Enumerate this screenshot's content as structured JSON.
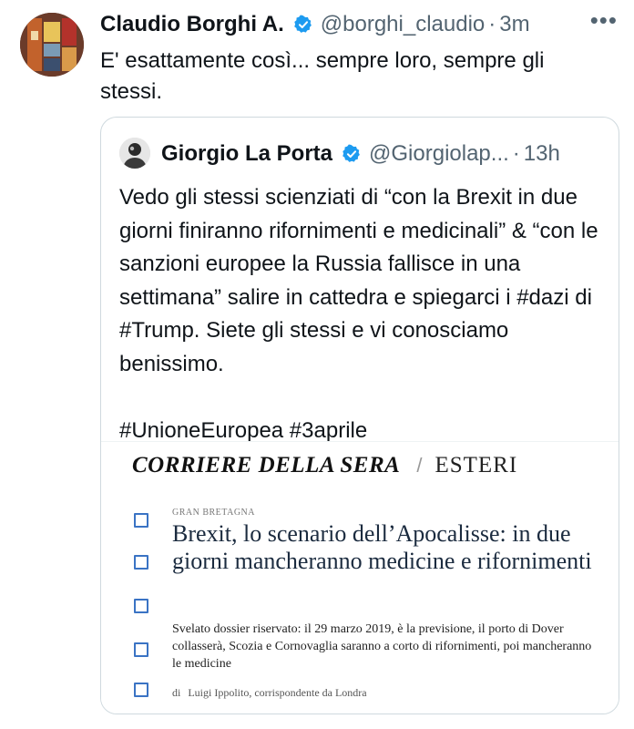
{
  "tweet": {
    "author_name": "Claudio Borghi A.",
    "handle": "@borghi_claudio",
    "separator": "·",
    "time": "3m",
    "more_icon": "more-icon",
    "verified_icon": "verified-badge-icon",
    "text": "E' esattamente così... sempre loro, sempre gli stessi."
  },
  "quoted_tweet": {
    "author_name": "Giorgio La Porta",
    "handle": "@Giorgiolap...",
    "separator": "·",
    "time": "13h",
    "verified_icon": "verified-badge-icon",
    "text": "Vedo gli stessi scienziati di “con la Brexit in due giorni finiranno rifornimenti e medicinali” & “con le sanzioni europee la Russia fallisce in una settimana” salire in cattedra e spiegarci i #dazi di #Trump. Siete gli stessi e vi conosciamo benissimo.\n\n#UnioneEuropea #3aprile"
  },
  "article_image": {
    "paper_name": "CORRIERE DELLA SERA",
    "separator": "/",
    "section": "ESTERI",
    "kicker": "GRAN BRETAGNA",
    "headline": "Brexit, lo scenario dell’Apocalisse: in due giorni mancheranno medicine e rifornimenti",
    "summary": "Svelato dossier riservato: il 29 marzo 2019, è la previsione, il porto di Dover collasserà, Scozia e Cornovaglia saranno a corto di rifornimenti, poi mancheranno le medicine",
    "byline_prefix": "di",
    "byline": "Luigi Ippolito, corrispondente da Londra",
    "accent_color": "#3a73c4"
  },
  "colors": {
    "text": "#0f1419",
    "secondary_text": "#536471",
    "verified": "#1d9bf0",
    "border": "#cfd9de"
  }
}
